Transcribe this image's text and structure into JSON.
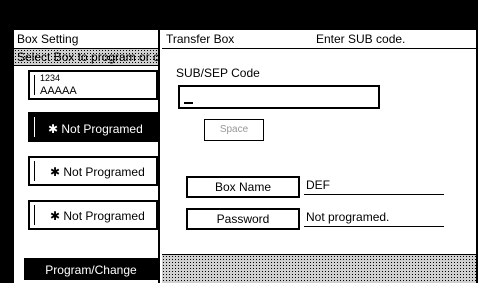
{
  "left_panel": {
    "title": "Box Setting",
    "subtitle": "Select Box to program or ch",
    "boxes": [
      {
        "number": "1234",
        "name": "AAAAA"
      },
      {
        "label": "✱ Not Programed"
      },
      {
        "label": "✱ Not Programed"
      },
      {
        "label": "✱ Not Programed"
      }
    ],
    "program_change_label": "Program/Change"
  },
  "right_panel": {
    "title": "Transfer Box",
    "message": "Enter SUB code.",
    "code_label": "SUB/SEP Code",
    "code_value": "",
    "space_label": "Space",
    "box_name_label": "Box Name",
    "box_name_value": "DEF",
    "password_label": "Password",
    "password_value": "Not programed."
  }
}
